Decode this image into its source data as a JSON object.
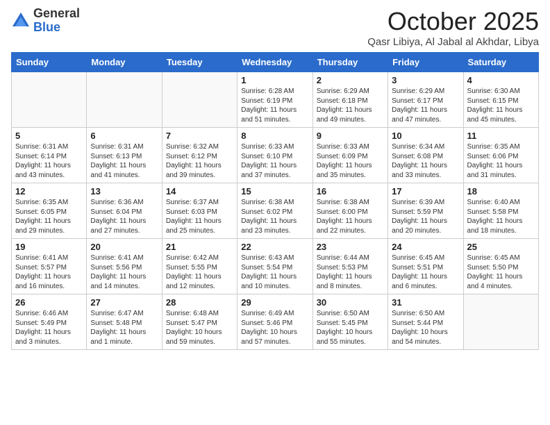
{
  "logo": {
    "general": "General",
    "blue": "Blue"
  },
  "title": "October 2025",
  "location": "Qasr Libiya, Al Jabal al Akhdar, Libya",
  "headers": [
    "Sunday",
    "Monday",
    "Tuesday",
    "Wednesday",
    "Thursday",
    "Friday",
    "Saturday"
  ],
  "weeks": [
    [
      {
        "day": "",
        "info": ""
      },
      {
        "day": "",
        "info": ""
      },
      {
        "day": "",
        "info": ""
      },
      {
        "day": "1",
        "info": "Sunrise: 6:28 AM\nSunset: 6:19 PM\nDaylight: 11 hours\nand 51 minutes."
      },
      {
        "day": "2",
        "info": "Sunrise: 6:29 AM\nSunset: 6:18 PM\nDaylight: 11 hours\nand 49 minutes."
      },
      {
        "day": "3",
        "info": "Sunrise: 6:29 AM\nSunset: 6:17 PM\nDaylight: 11 hours\nand 47 minutes."
      },
      {
        "day": "4",
        "info": "Sunrise: 6:30 AM\nSunset: 6:15 PM\nDaylight: 11 hours\nand 45 minutes."
      }
    ],
    [
      {
        "day": "5",
        "info": "Sunrise: 6:31 AM\nSunset: 6:14 PM\nDaylight: 11 hours\nand 43 minutes."
      },
      {
        "day": "6",
        "info": "Sunrise: 6:31 AM\nSunset: 6:13 PM\nDaylight: 11 hours\nand 41 minutes."
      },
      {
        "day": "7",
        "info": "Sunrise: 6:32 AM\nSunset: 6:12 PM\nDaylight: 11 hours\nand 39 minutes."
      },
      {
        "day": "8",
        "info": "Sunrise: 6:33 AM\nSunset: 6:10 PM\nDaylight: 11 hours\nand 37 minutes."
      },
      {
        "day": "9",
        "info": "Sunrise: 6:33 AM\nSunset: 6:09 PM\nDaylight: 11 hours\nand 35 minutes."
      },
      {
        "day": "10",
        "info": "Sunrise: 6:34 AM\nSunset: 6:08 PM\nDaylight: 11 hours\nand 33 minutes."
      },
      {
        "day": "11",
        "info": "Sunrise: 6:35 AM\nSunset: 6:06 PM\nDaylight: 11 hours\nand 31 minutes."
      }
    ],
    [
      {
        "day": "12",
        "info": "Sunrise: 6:35 AM\nSunset: 6:05 PM\nDaylight: 11 hours\nand 29 minutes."
      },
      {
        "day": "13",
        "info": "Sunrise: 6:36 AM\nSunset: 6:04 PM\nDaylight: 11 hours\nand 27 minutes."
      },
      {
        "day": "14",
        "info": "Sunrise: 6:37 AM\nSunset: 6:03 PM\nDaylight: 11 hours\nand 25 minutes."
      },
      {
        "day": "15",
        "info": "Sunrise: 6:38 AM\nSunset: 6:02 PM\nDaylight: 11 hours\nand 23 minutes."
      },
      {
        "day": "16",
        "info": "Sunrise: 6:38 AM\nSunset: 6:00 PM\nDaylight: 11 hours\nand 22 minutes."
      },
      {
        "day": "17",
        "info": "Sunrise: 6:39 AM\nSunset: 5:59 PM\nDaylight: 11 hours\nand 20 minutes."
      },
      {
        "day": "18",
        "info": "Sunrise: 6:40 AM\nSunset: 5:58 PM\nDaylight: 11 hours\nand 18 minutes."
      }
    ],
    [
      {
        "day": "19",
        "info": "Sunrise: 6:41 AM\nSunset: 5:57 PM\nDaylight: 11 hours\nand 16 minutes."
      },
      {
        "day": "20",
        "info": "Sunrise: 6:41 AM\nSunset: 5:56 PM\nDaylight: 11 hours\nand 14 minutes."
      },
      {
        "day": "21",
        "info": "Sunrise: 6:42 AM\nSunset: 5:55 PM\nDaylight: 11 hours\nand 12 minutes."
      },
      {
        "day": "22",
        "info": "Sunrise: 6:43 AM\nSunset: 5:54 PM\nDaylight: 11 hours\nand 10 minutes."
      },
      {
        "day": "23",
        "info": "Sunrise: 6:44 AM\nSunset: 5:53 PM\nDaylight: 11 hours\nand 8 minutes."
      },
      {
        "day": "24",
        "info": "Sunrise: 6:45 AM\nSunset: 5:51 PM\nDaylight: 11 hours\nand 6 minutes."
      },
      {
        "day": "25",
        "info": "Sunrise: 6:45 AM\nSunset: 5:50 PM\nDaylight: 11 hours\nand 4 minutes."
      }
    ],
    [
      {
        "day": "26",
        "info": "Sunrise: 6:46 AM\nSunset: 5:49 PM\nDaylight: 11 hours\nand 3 minutes."
      },
      {
        "day": "27",
        "info": "Sunrise: 6:47 AM\nSunset: 5:48 PM\nDaylight: 11 hours\nand 1 minute."
      },
      {
        "day": "28",
        "info": "Sunrise: 6:48 AM\nSunset: 5:47 PM\nDaylight: 10 hours\nand 59 minutes."
      },
      {
        "day": "29",
        "info": "Sunrise: 6:49 AM\nSunset: 5:46 PM\nDaylight: 10 hours\nand 57 minutes."
      },
      {
        "day": "30",
        "info": "Sunrise: 6:50 AM\nSunset: 5:45 PM\nDaylight: 10 hours\nand 55 minutes."
      },
      {
        "day": "31",
        "info": "Sunrise: 6:50 AM\nSunset: 5:44 PM\nDaylight: 10 hours\nand 54 minutes."
      },
      {
        "day": "",
        "info": ""
      }
    ]
  ]
}
